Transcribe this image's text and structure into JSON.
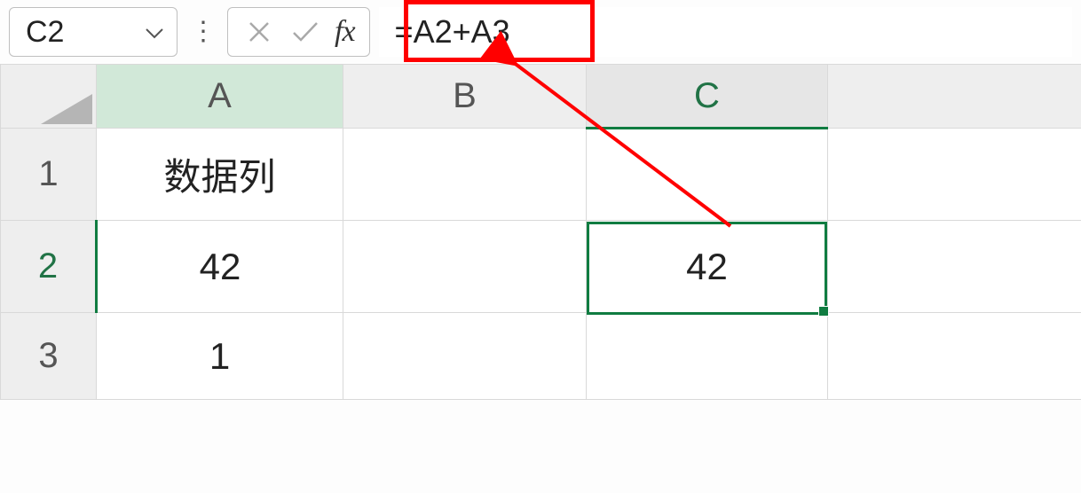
{
  "name_box": {
    "value": "C2"
  },
  "formula_bar": {
    "fx_label": "fx",
    "formula": "=A2+A3"
  },
  "columns": [
    "A",
    "B",
    "C"
  ],
  "rows": [
    "1",
    "2",
    "3"
  ],
  "active_cell": "C2",
  "cells": {
    "A1": "数据列",
    "B1": "",
    "C1": "",
    "A2": "42",
    "B2": "",
    "C2": "42",
    "A3": "1",
    "B3": "",
    "C3": ""
  },
  "annotation": {
    "highlight_target": "formula",
    "arrow_from": "formula-bar",
    "arrow_to": "C2",
    "color": "#ff0000"
  }
}
